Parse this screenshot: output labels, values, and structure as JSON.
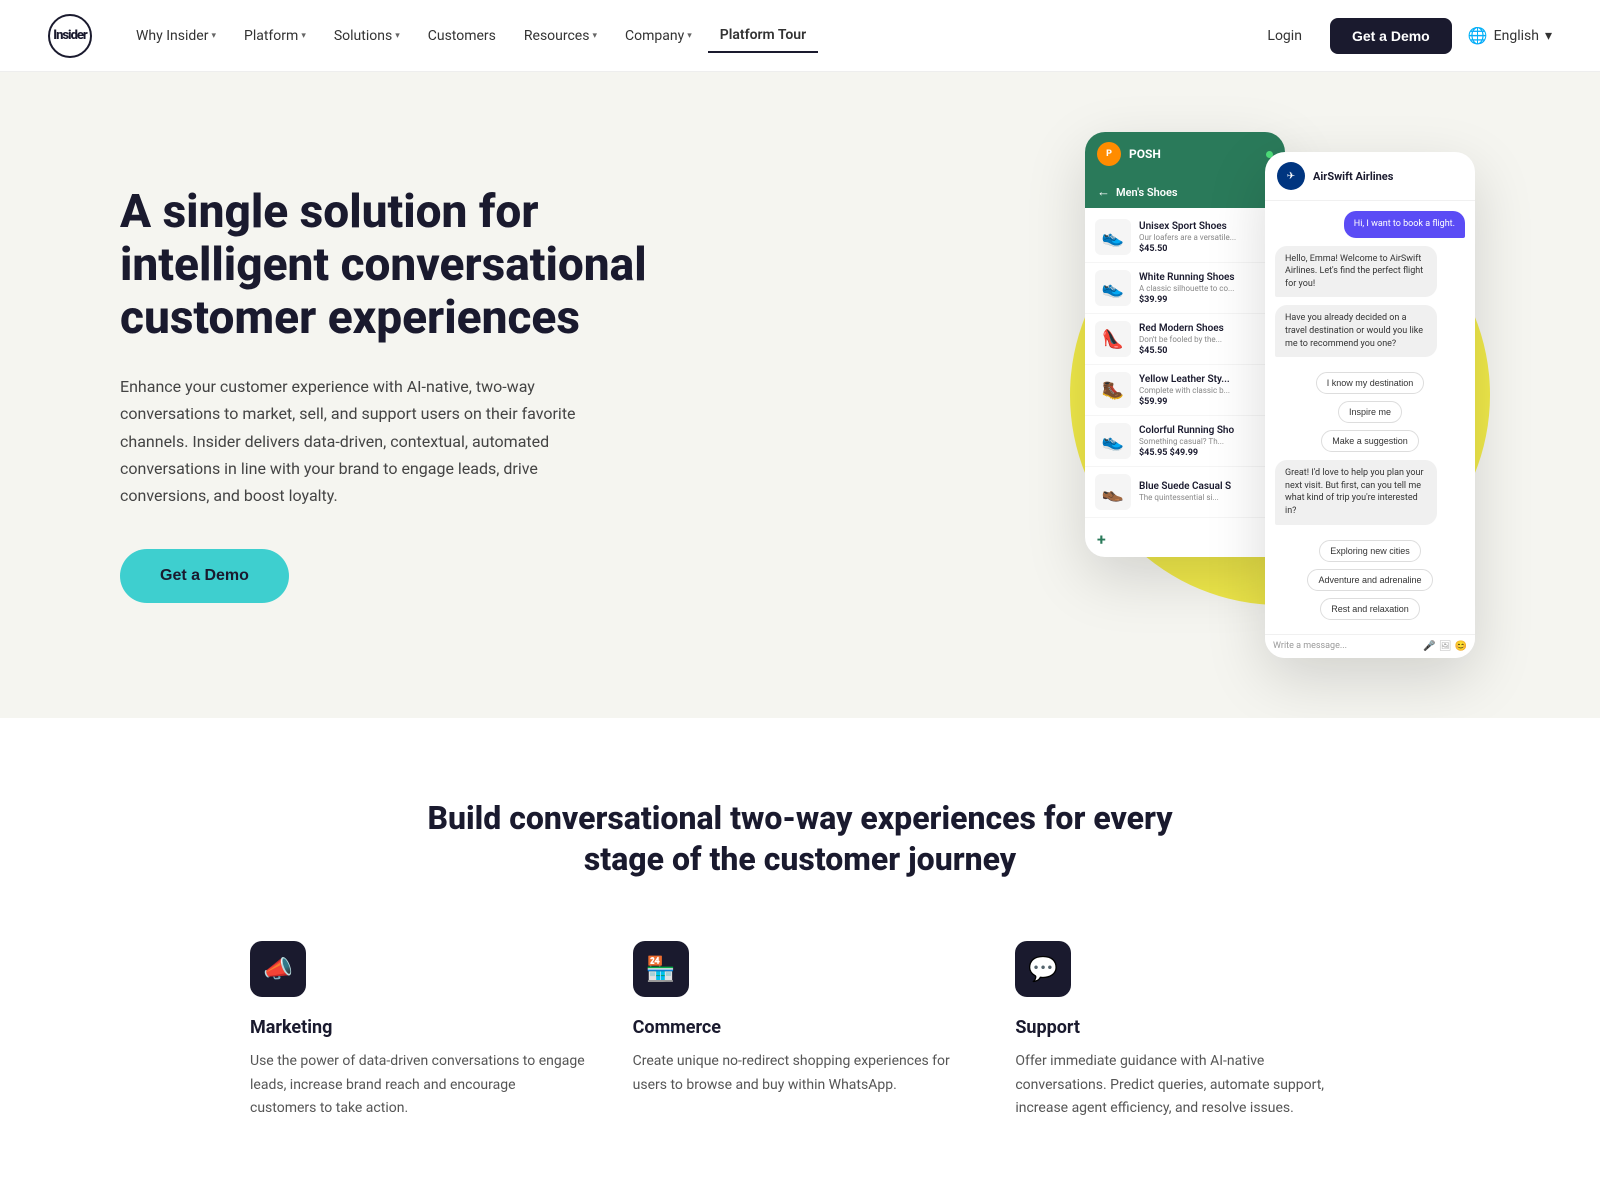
{
  "nav": {
    "logo_text": "Insider",
    "links": [
      {
        "label": "Why Insider",
        "hasDropdown": true,
        "active": false
      },
      {
        "label": "Platform",
        "hasDropdown": true,
        "active": false
      },
      {
        "label": "Solutions",
        "hasDropdown": true,
        "active": false
      },
      {
        "label": "Customers",
        "hasDropdown": false,
        "active": false
      },
      {
        "label": "Resources",
        "hasDropdown": true,
        "active": false
      },
      {
        "label": "Company",
        "hasDropdown": true,
        "active": false
      },
      {
        "label": "Platform Tour",
        "hasDropdown": false,
        "active": true
      }
    ],
    "login_label": "Login",
    "demo_label": "Get a Demo",
    "lang_label": "English"
  },
  "hero": {
    "title": "A single solution for intelligent conversational customer experiences",
    "description": "Enhance your customer experience with AI-native, two-way conversations to market, sell, and support users on their favorite channels. Insider delivers data-driven, contextual, automated conversations in line with your brand to engage leads, drive conversions, and boost loyalty.",
    "cta_label": "Get a Demo"
  },
  "posh_mockup": {
    "brand": "POSH",
    "section": "Men's Shoes",
    "items": [
      {
        "name": "Unisex Sport Shoes",
        "desc": "Our loafers are a versatile...",
        "price": "$45.50",
        "emoji": "👟"
      },
      {
        "name": "White Running Shoes",
        "desc": "A classic silhouette to co...",
        "price": "$39.99",
        "emoji": "👟"
      },
      {
        "name": "Red Modern Shoes",
        "desc": "Don't be fooled by the...",
        "price": "$45.50",
        "emoji": "👠"
      },
      {
        "name": "Yellow Leather Sty...",
        "desc": "Complete with classic b...",
        "price": "$59.99",
        "emoji": "🥾"
      },
      {
        "name": "Colorful Running Sho",
        "desc": "Something casual? Th...",
        "price": "$45.95  $49.99",
        "emoji": "👟"
      },
      {
        "name": "Blue Suede Casual S",
        "desc": "The quintessential si...",
        "price": "",
        "emoji": "👞"
      }
    ]
  },
  "chat_mockup": {
    "airline": "AirSwift Airlines",
    "messages": [
      {
        "type": "right",
        "text": "Hi, I want to book a flight."
      },
      {
        "type": "left",
        "text": "Hello, Emma! Welcome to AirSwift Airlines. Let's find the perfect flight for you!"
      },
      {
        "type": "left",
        "text": "Have you already decided on a travel destination or would you like me to recommend you one?"
      },
      {
        "type": "option",
        "text": "I know my destination"
      },
      {
        "type": "option_right",
        "text": "Inspire me"
      },
      {
        "type": "option_right",
        "text": "Make a suggestion"
      },
      {
        "type": "left",
        "text": "Great! I'd love to help you plan your next visit. But first, can you tell me what kind of trip you're interested in?"
      },
      {
        "type": "option",
        "text": "Exploring new cities"
      },
      {
        "type": "option",
        "text": "Adventure and adrenaline"
      },
      {
        "type": "option",
        "text": "Rest and relaxation"
      }
    ],
    "input_placeholder": "Write a message..."
  },
  "section2": {
    "title": "Build conversational two-way experiences for every stage of the customer journey",
    "features": [
      {
        "icon": "📣",
        "title": "Marketing",
        "description": "Use the power of data-driven conversations to engage leads, increase brand reach and encourage customers to take action."
      },
      {
        "icon": "🏪",
        "title": "Commerce",
        "description": "Create unique no-redirect shopping experiences for users to browse and buy within WhatsApp."
      },
      {
        "icon": "💬",
        "title": "Support",
        "description": "Offer immediate guidance with AI-native conversations. Predict queries, automate support, increase agent efficiency, and resolve issues."
      }
    ]
  }
}
